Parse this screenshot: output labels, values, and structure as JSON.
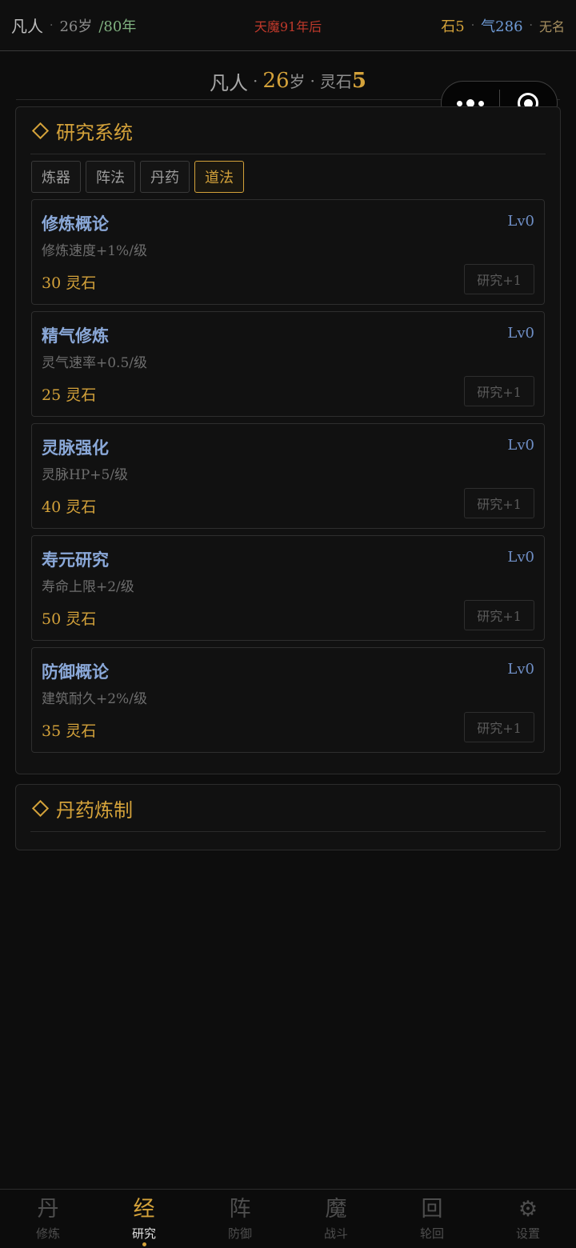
{
  "topbar": {
    "realm": "凡人",
    "age": "26岁",
    "lifespan": "/80年",
    "demon_countdown": "天魔91年后",
    "stones": "石5",
    "qi": "气286",
    "name": "无名",
    "separator": "·"
  },
  "summary": {
    "realm": "凡人",
    "sep": "·",
    "age_num": "26",
    "age_unit": "岁",
    "stone_label": "灵石",
    "stone_num": "5"
  },
  "research": {
    "title": "研究系统",
    "tabs": [
      {
        "label": "炼器",
        "active": false
      },
      {
        "label": "阵法",
        "active": false
      },
      {
        "label": "丹药",
        "active": false
      },
      {
        "label": "道法",
        "active": true
      }
    ],
    "items": [
      {
        "name": "修炼概论",
        "level": "Lv0",
        "desc": "修炼速度+1%/级",
        "cost": "30 灵石",
        "button": "研究+1"
      },
      {
        "name": "精气修炼",
        "level": "Lv0",
        "desc": "灵气速率+0.5/级",
        "cost": "25 灵石",
        "button": "研究+1"
      },
      {
        "name": "灵脉强化",
        "level": "Lv0",
        "desc": "灵脉HP+5/级",
        "cost": "40 灵石",
        "button": "研究+1"
      },
      {
        "name": "寿元研究",
        "level": "Lv0",
        "desc": "寿命上限+2/级",
        "cost": "50 灵石",
        "button": "研究+1"
      },
      {
        "name": "防御概论",
        "level": "Lv0",
        "desc": "建筑耐久+2%/级",
        "cost": "35 灵石",
        "button": "研究+1"
      }
    ]
  },
  "alchemy": {
    "title": "丹药炼制"
  },
  "nav": [
    {
      "icon": "丹",
      "label": "修炼",
      "active": false
    },
    {
      "icon": "经",
      "label": "研究",
      "active": true
    },
    {
      "icon": "阵",
      "label": "防御",
      "active": false
    },
    {
      "icon": "魔",
      "label": "战斗",
      "active": false
    },
    {
      "icon": "回",
      "label": "轮回",
      "active": false
    },
    {
      "icon": "⚙",
      "label": "设置",
      "active": false
    }
  ],
  "colors": {
    "accent": "#d4a23a",
    "skill_name": "#8aa8d8",
    "danger": "#c0392b"
  }
}
